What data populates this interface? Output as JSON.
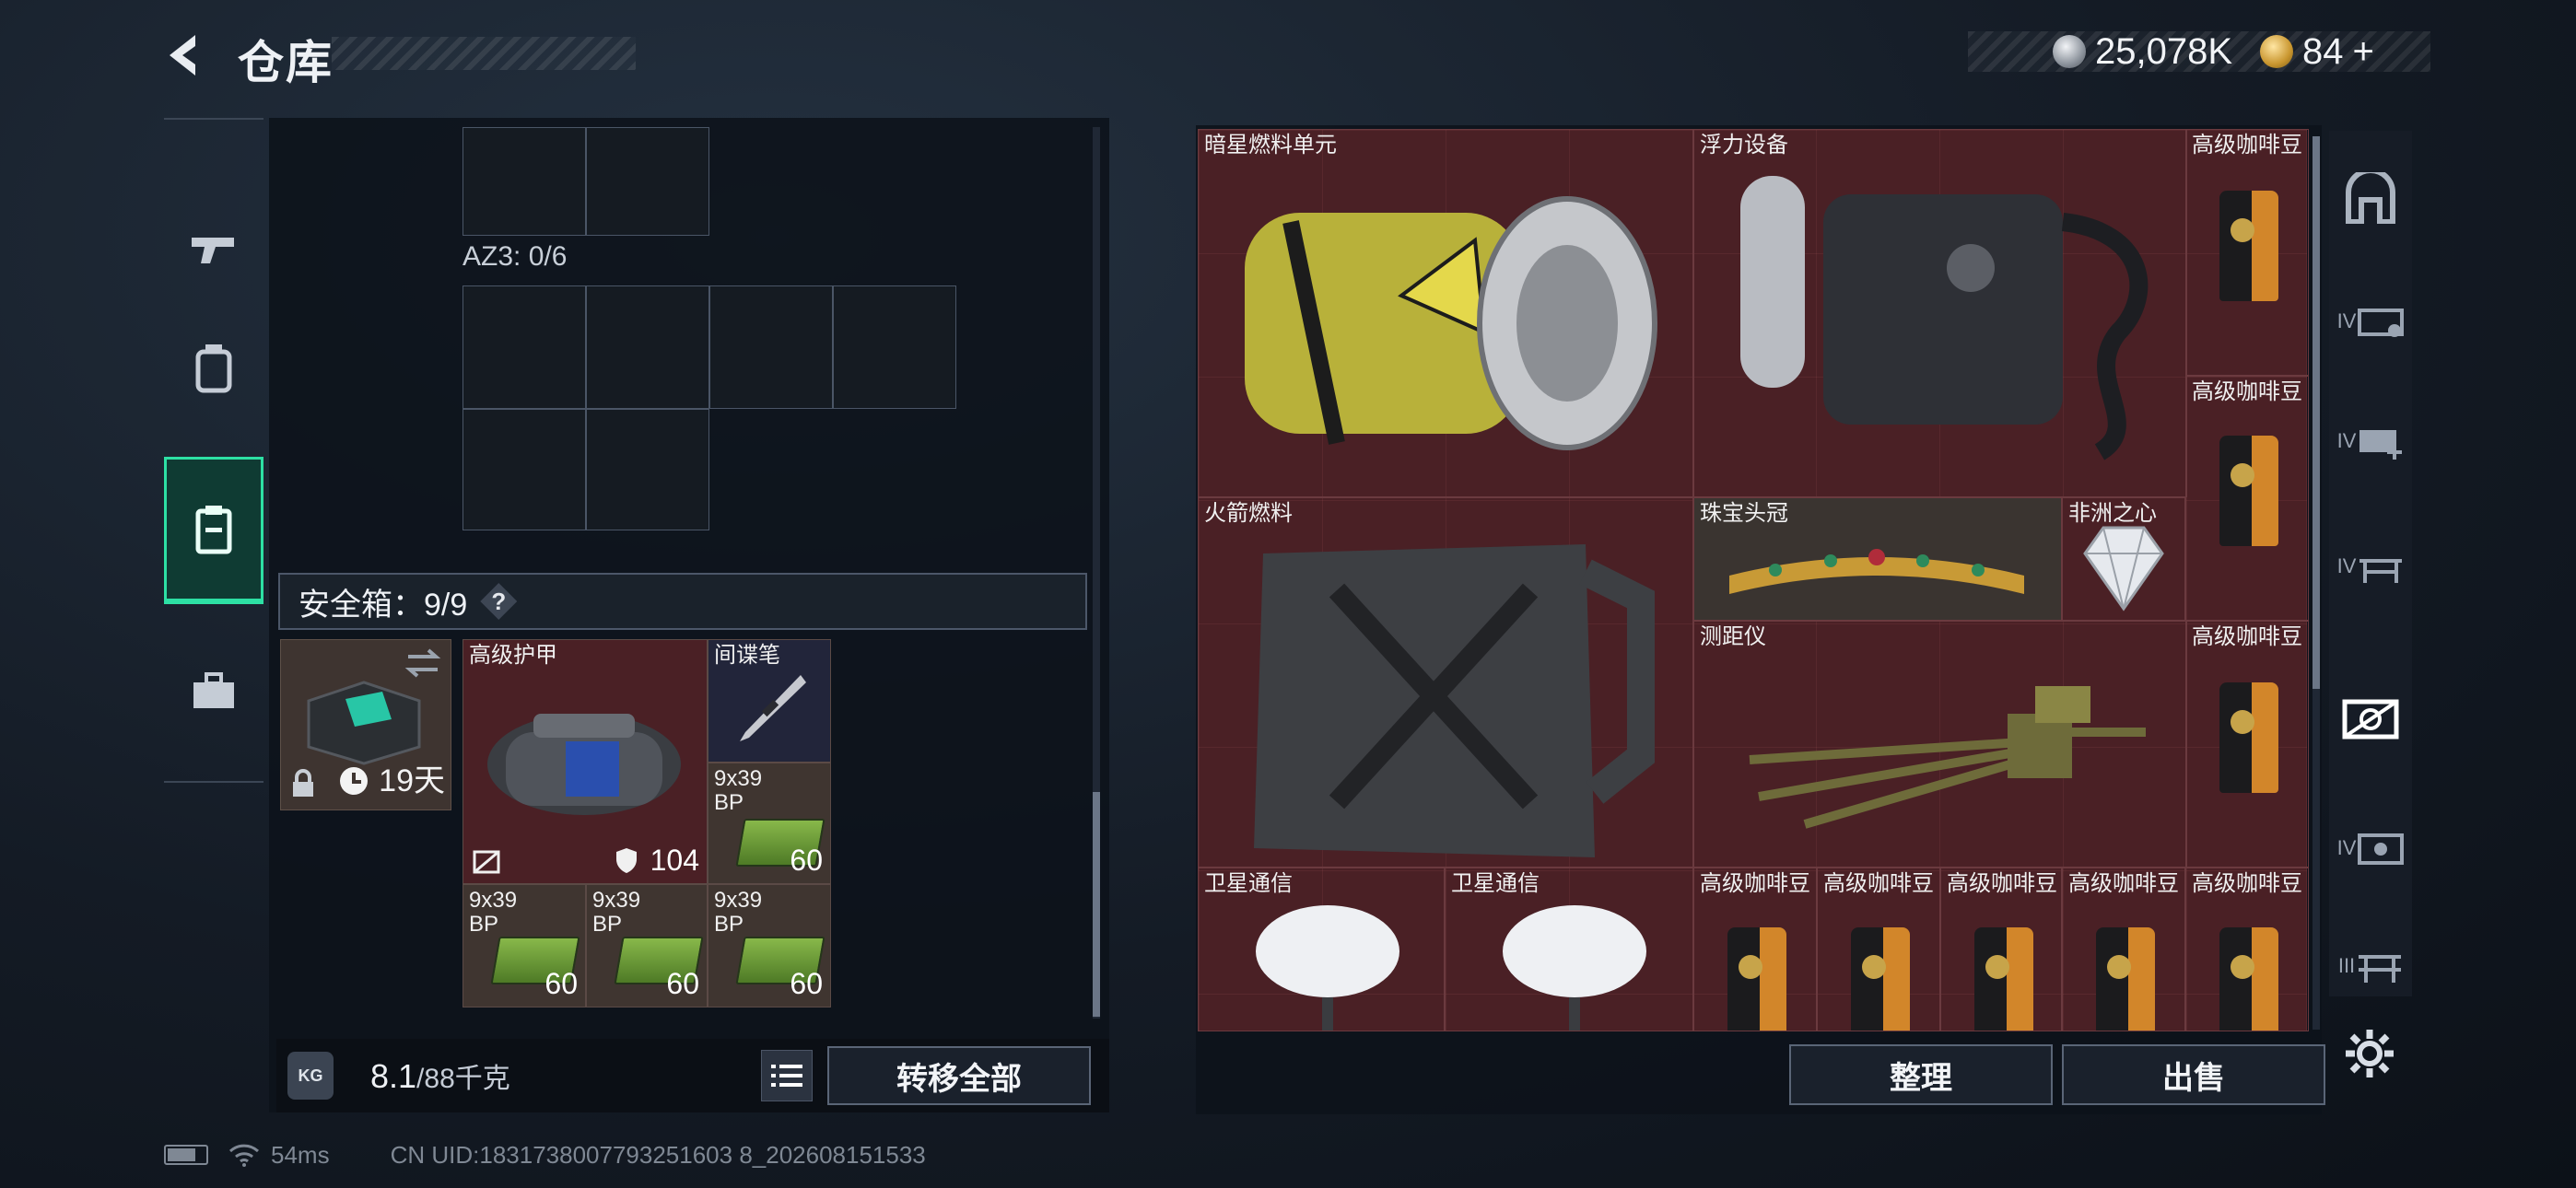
{
  "header": {
    "title": "仓库",
    "silver_amount": "25,078K",
    "gold_amount": "84",
    "gold_plus": "+"
  },
  "left_nav": {
    "items": [
      "weapon",
      "backpack",
      "stash-case",
      "toolbox"
    ],
    "active_index": 2
  },
  "left_panel": {
    "az3_label": "AZ3: 0/6",
    "safe_box_label": "安全箱：9/9",
    "safe_box_help": "?",
    "safe_box_days": "19天",
    "items": {
      "armor": {
        "label": "高级护甲",
        "durability": "104"
      },
      "pen": {
        "label": "间谍笔"
      },
      "ammo": [
        {
          "label": "9x39\nBP",
          "count": "60"
        },
        {
          "label": "9x39\nBP",
          "count": "60"
        },
        {
          "label": "9x39\nBP",
          "count": "60"
        },
        {
          "label": "9x39\nBP",
          "count": "60"
        }
      ]
    },
    "weight_current": "8.1",
    "weight_max": "/88千克",
    "kg_label": "KG",
    "transfer_label": "转移全部"
  },
  "stash": {
    "items": {
      "fuel_cell": "暗星燃料单元",
      "float_device": "浮力设备",
      "rocket_fuel": "火箭燃料",
      "crown": "珠宝头冠",
      "heart": "非洲之心",
      "rangefinder": "测距仪",
      "satcom_1": "卫星通信",
      "satcom_2": "卫星通信",
      "coffee": "高级咖啡豆"
    },
    "coffee_positions": 8,
    "sort_label": "整理",
    "sell_label": "出售"
  },
  "status": {
    "ping": "54ms",
    "uid": "CN UID:1831738007793251603 8_202608151533"
  },
  "colors": {
    "accent": "#2de0a4",
    "stash_bg": "#4a2025"
  }
}
